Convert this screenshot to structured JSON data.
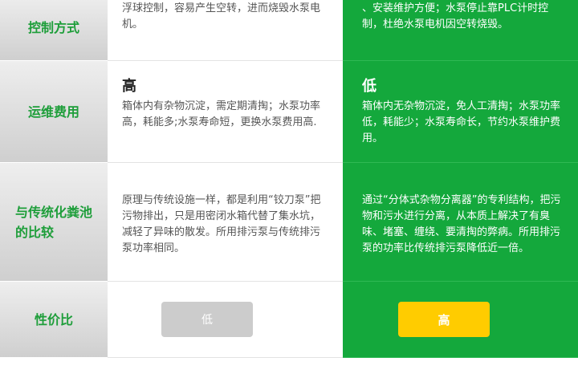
{
  "rows": [
    {
      "label": "控制方式",
      "traditional": {
        "text": "浮球控制，容易产生空转，进而烧毁水泵电机。"
      },
      "new": {
        "text": "、安装维护方便；水泵停止靠PLC计时控制，杜绝水泵电机因空转烧毁。"
      }
    },
    {
      "label": "运维费用",
      "traditional": {
        "heading": "高",
        "text": "箱体内有杂物沉淀，需定期清掏；水泵功率高，耗能多;水泵寿命短，更换水泵费用高."
      },
      "new": {
        "heading": "低",
        "text": "箱体内无杂物沉淀，免人工清掏；水泵功率低，耗能少；水泵寿命长，节约水泵维护费用。"
      }
    },
    {
      "label": "与传统化粪池的比较",
      "traditional": {
        "text": "原理与传统设施一样，都是利用“铰刀泵”把污物排出，只是用密闭水箱代替了集水坑，减轻了异味的散发。所用排污泵与传统排污泵功率相同。"
      },
      "new": {
        "text": "通过“分体式杂物分离器”的专利结构，把污物和污水进行分离，从本质上解决了有臭味、堵塞、缠绕、要清掏的弊病。所用排污泵的功率比传统排污泵降低近一倍。"
      }
    },
    {
      "label": "性价比",
      "traditional": {
        "button": "低"
      },
      "new": {
        "button": "高"
      }
    }
  ],
  "colors": {
    "accent_green": "#14a83c",
    "label_green": "#1e9e3a",
    "button_yellow": "#ffcc00",
    "button_gray": "#cccccc"
  }
}
